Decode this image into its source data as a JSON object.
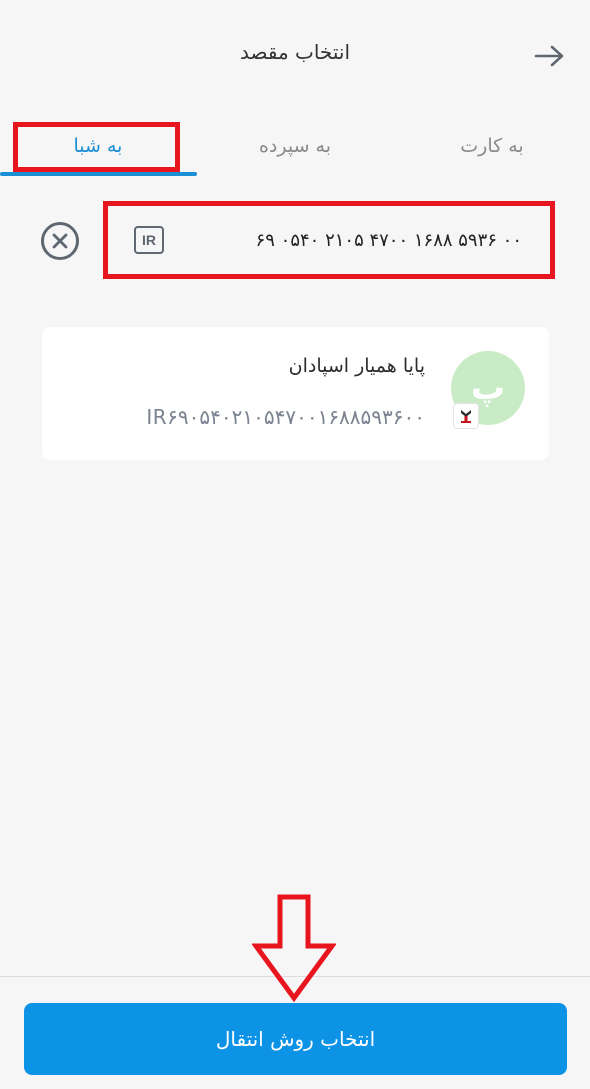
{
  "header": {
    "title": "انتخاب مقصد",
    "back_icon": "arrow-right-icon"
  },
  "tabs": [
    {
      "label": "به شبا",
      "active": true
    },
    {
      "label": "به سپرده",
      "active": false
    },
    {
      "label": "به کارت",
      "active": false
    }
  ],
  "sheba_input": {
    "prefix": "IR",
    "value": "۶۹ ۰۵۴۰ ۲۱۰۵ ۴۷۰۰ ۱۶۸۸ ۵۹۳۶ ۰۰",
    "clear_icon": "close-circle-icon"
  },
  "account": {
    "avatar_letter": "پ",
    "name": "پایا همیار اسپادان",
    "iban": "IR۶۹۰۵۴۰۲۱۰۵۴۷۰۰۱۶۸۸۵۹۳۶۰۰",
    "bank_logo_icon": "bank-logo-icon"
  },
  "footer": {
    "button_label": "انتخاب روش انتقال"
  },
  "colors": {
    "accent": "#1a8fd6",
    "button": "#0d93e6",
    "annotation": "#e8151e",
    "avatar_bg": "#c9ebc6"
  }
}
